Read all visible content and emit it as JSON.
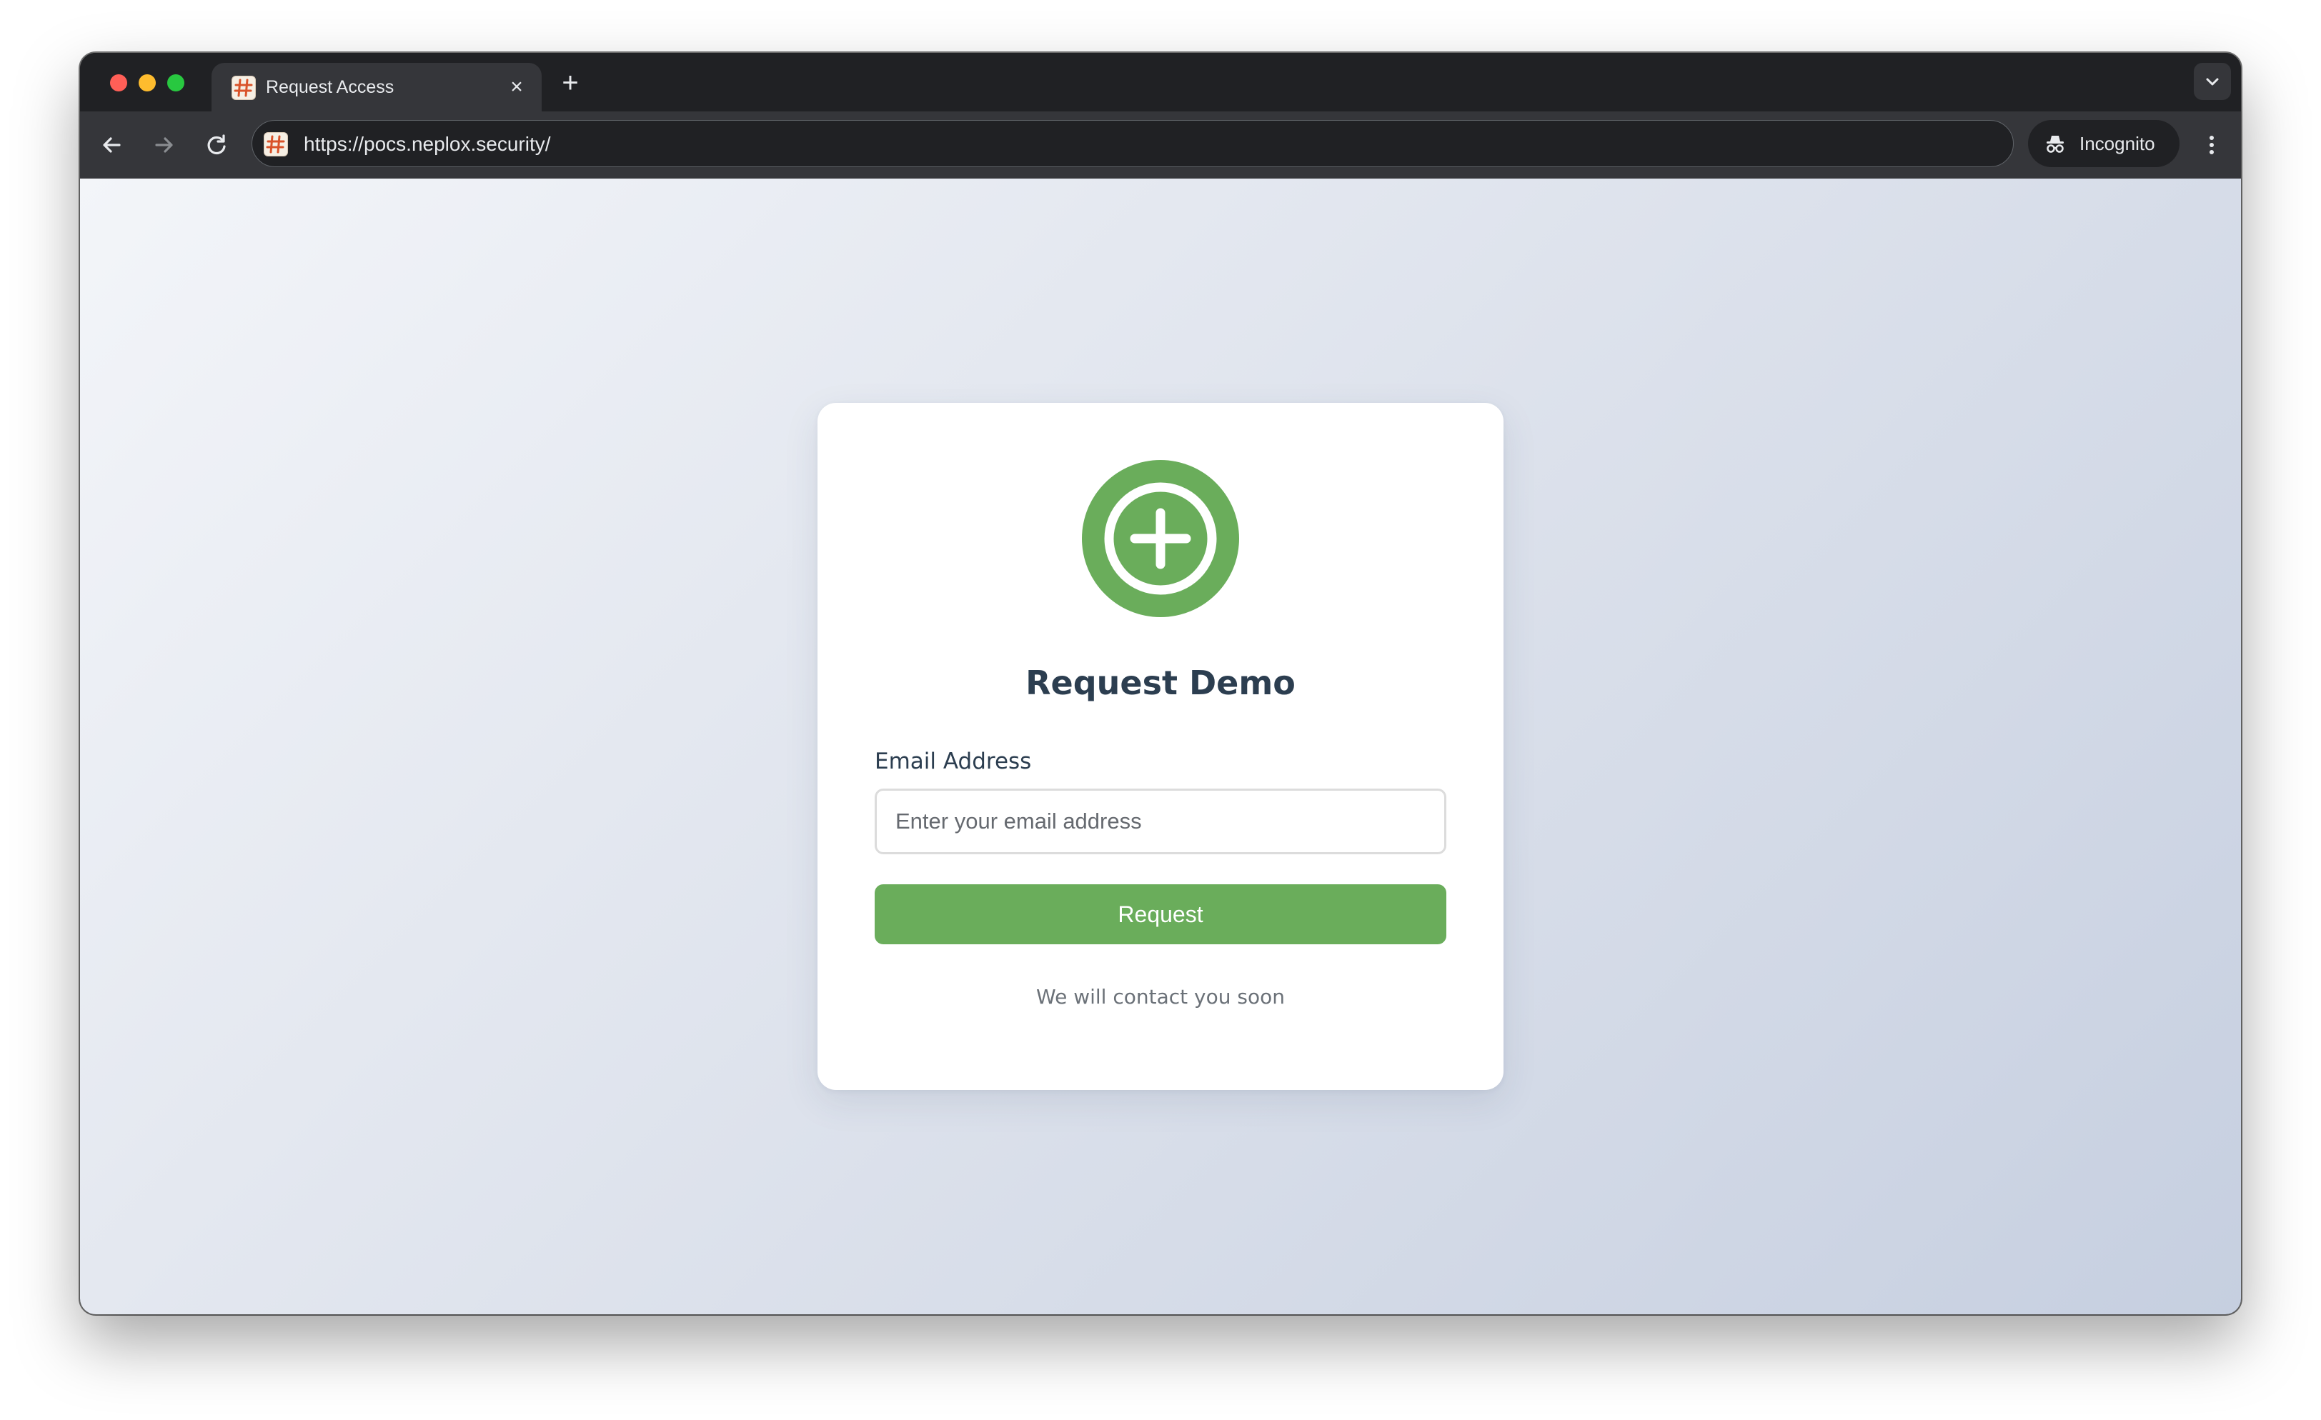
{
  "browser": {
    "tab": {
      "title": "Request Access",
      "close_icon": "close-icon",
      "favicon": "site-favicon"
    },
    "new_tab_icon": "plus-icon",
    "url": "https://pocs.neplox.security/",
    "incognito_label": "Incognito",
    "icons": {
      "back": "arrow-left-icon",
      "forward": "arrow-right-icon",
      "reload": "reload-icon",
      "menu": "more-vertical-icon",
      "tab_search": "chevron-down-icon",
      "incognito": "incognito-icon"
    }
  },
  "page": {
    "logo_icon": "plus-circle-icon",
    "title": "Request Demo",
    "email": {
      "label": "Email Address",
      "placeholder": "Enter your email address",
      "value": ""
    },
    "submit_label": "Request",
    "footnote": "We will contact you soon"
  },
  "colors": {
    "accent": "#6aad5b",
    "title": "#2c3e50",
    "muted": "#6b7178"
  }
}
